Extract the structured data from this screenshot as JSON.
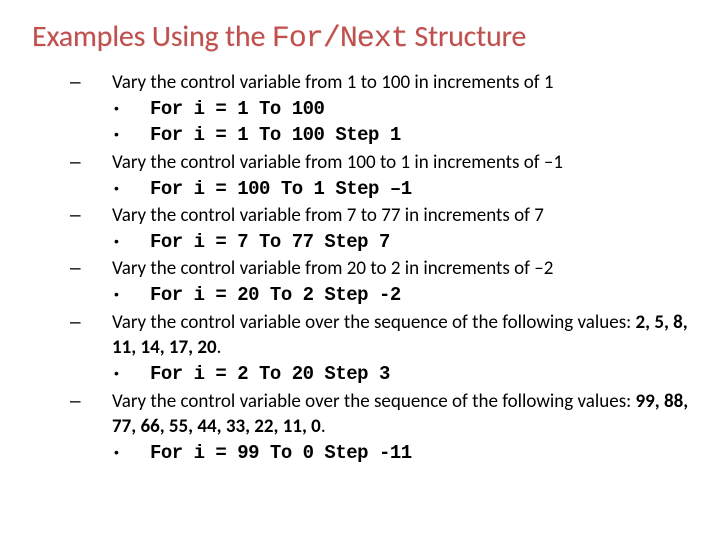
{
  "title": {
    "prefix": "Examples Using the ",
    "codepart": "For/Next",
    "suffix": " Structure"
  },
  "bullets": {
    "dash": "–",
    "disc": "•"
  },
  "items": [
    {
      "text": "Vary the control variable from 1 to 100 in increments of 1",
      "codes": [
        "For i = 1 To 100",
        "For i = 1 To 100 Step 1"
      ]
    },
    {
      "text": "Vary the control variable from 100 to 1 in increments of –1",
      "codes": [
        "For i = 100 To 1 Step –1"
      ]
    },
    {
      "text": "Vary the control variable from 7 to 77 in increments of 7",
      "codes": [
        "For i = 7 To 77 Step 7"
      ]
    },
    {
      "text": "Vary the control variable from 20 to 2 in increments of –2",
      "codes": [
        "For i = 20 To 2 Step -2"
      ]
    },
    {
      "text_pre": "Vary the control variable over the sequence of the following values: ",
      "text_bold": "2, 5, 8, 11, 14, 17, 20",
      "text_post": ".",
      "codes": [
        "For i = 2 To 20 Step 3"
      ]
    },
    {
      "text_pre": "Vary the control variable over the sequence of the following values: ",
      "text_bold": "99, 88, 77, 66, 55, 44, 33, 22, 11, 0",
      "text_post": ".",
      "codes": [
        "For i = 99 To 0 Step -11"
      ]
    }
  ]
}
